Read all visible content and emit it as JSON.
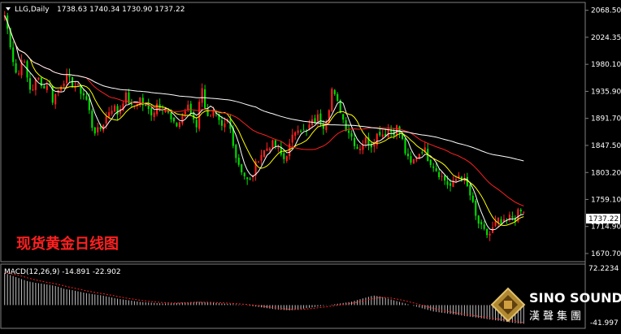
{
  "header": {
    "symbol": "LLG,Daily",
    "ohlc": "1738.63 1740.34 1730.90 1737.22"
  },
  "title_overlay": "现货黄金日线图",
  "price_axis": {
    "ticks": [
      "2068.50",
      "2024.35",
      "1980.10",
      "1935.90",
      "1891.70",
      "1847.50",
      "1803.20",
      "1759.10",
      "1714.90",
      "1670.70"
    ],
    "current_price": "1737.22"
  },
  "macd": {
    "label": "MACD(12,26,9) -14.891 -22.902",
    "axis_top": "72.2234",
    "axis_bottom": "-41.997"
  },
  "logo": {
    "name": "SINO SOUND",
    "sub": "漢聲集團"
  },
  "colors": {
    "bull": "#ff2020",
    "bear": "#00e000",
    "ma_fast": "#ffffff",
    "ma_mid": "#ffff00",
    "ma_slow": "#ff2020",
    "ma_long": "#ffffff",
    "macd_bar": "#c0c0c0",
    "signal": "#ff2020"
  },
  "chart_data": {
    "type": "candlestick",
    "timeframe": "Daily",
    "ylim": [
      1660,
      2080
    ],
    "macd_ylim": [
      -41.997,
      72.2234
    ],
    "close_path": [
      2060,
      2025,
      1985,
      1955,
      1998,
      1962,
      1935,
      1950,
      1958,
      1940,
      1953,
      1922,
      1935,
      1948,
      1960,
      1952,
      1946,
      1940,
      1932,
      1918,
      1880,
      1868,
      1875,
      1890,
      1905,
      1912,
      1898,
      1920,
      1930,
      1908,
      1915,
      1925,
      1910,
      1905,
      1900,
      1918,
      1912,
      1908,
      1890,
      1878,
      1885,
      1900,
      1910,
      1896,
      1880,
      1948,
      1910,
      1890,
      1900,
      1885,
      1872,
      1890,
      1868,
      1830,
      1812,
      1798,
      1785,
      1802,
      1826,
      1835,
      1842,
      1850,
      1848,
      1835,
      1825,
      1840,
      1860,
      1880,
      1875,
      1865,
      1882,
      1888,
      1895,
      1880,
      1895,
      1940,
      1920,
      1905,
      1880,
      1870,
      1855,
      1842,
      1850,
      1858,
      1848,
      1862,
      1870,
      1865,
      1875,
      1868,
      1878,
      1860,
      1832,
      1815,
      1825,
      1835,
      1845,
      1828,
      1818,
      1808,
      1798,
      1790,
      1780,
      1785,
      1800,
      1795,
      1780,
      1760,
      1730,
      1715,
      1705,
      1700,
      1712,
      1725,
      1718,
      1722,
      1732,
      1728,
      1740,
      1737
    ],
    "ma_periods_implied": [
      "fast",
      "mid",
      "slow",
      "long"
    ],
    "macd_hist_path": [
      60,
      55,
      50,
      45,
      42,
      40,
      38,
      35,
      30,
      28,
      25,
      22,
      20,
      18,
      15,
      12,
      10,
      8,
      6,
      5,
      4,
      3,
      3,
      4,
      5,
      6,
      6,
      5,
      4,
      3,
      2,
      1,
      0,
      -2,
      -4,
      -6,
      -8,
      -9,
      -10,
      -8,
      -6,
      -4,
      -2,
      0,
      2,
      4,
      6,
      10,
      14,
      18,
      16,
      12,
      8,
      4,
      0,
      -4,
      -8,
      -12,
      -14,
      -16,
      -18,
      -20,
      -22,
      -24,
      -26,
      -28,
      -30,
      -32,
      -34,
      -35
    ]
  }
}
